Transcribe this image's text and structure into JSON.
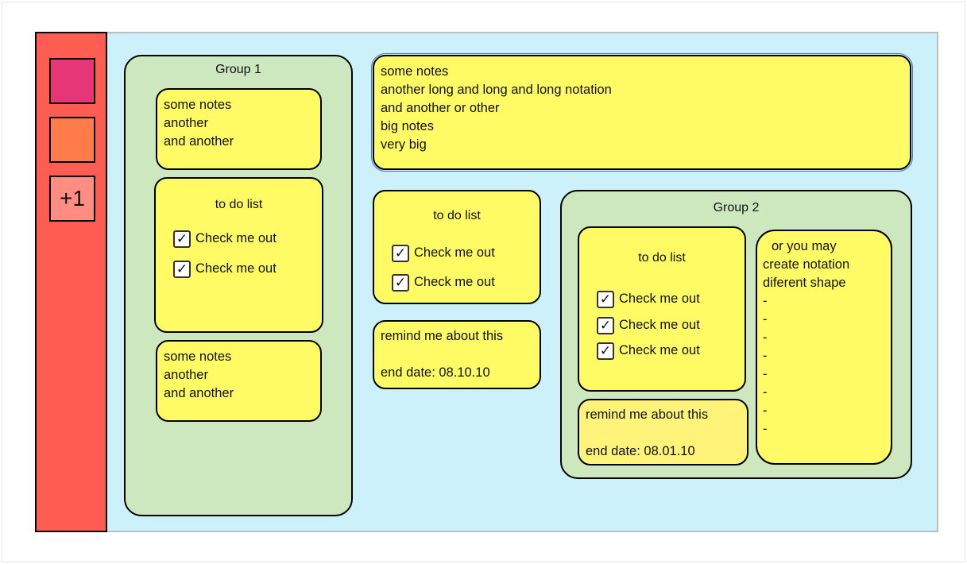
{
  "colors": {
    "sidebar": "#ff5c52",
    "canvas": "#ccf1fb",
    "group": "#cde8bf",
    "note": "#fffb65",
    "swatch_pink": "#e73677",
    "swatch_orange": "#ff7b4a",
    "swatch_salmon": "#ff8d82"
  },
  "sidebar": {
    "plus_label": "+1"
  },
  "group1": {
    "title": "Group 1",
    "note_top": [
      "some notes",
      "another",
      "and another"
    ],
    "todo": {
      "title": "to do list",
      "items": [
        "Check me out",
        "Check me out"
      ]
    },
    "note_bottom": [
      "some notes",
      "another",
      "and another"
    ]
  },
  "big_note": [
    "some notes",
    "another long and long and long notation",
    "and another or other",
    "big notes",
    "very big"
  ],
  "middle": {
    "todo": {
      "title": "to do list",
      "items": [
        "Check me out",
        "Check me out"
      ]
    },
    "remind": {
      "text": "remind me about this",
      "date": "end date: 08.10.10"
    }
  },
  "group2": {
    "title": "Group 2",
    "todo": {
      "title": "to do list",
      "items": [
        "Check me out",
        "Check me out",
        "Check me out"
      ]
    },
    "remind": {
      "text": "remind me about this",
      "date": "end date: 08.01.10"
    },
    "shape_note": {
      "lines": [
        "or you may",
        "create notation",
        "diferent shape"
      ],
      "dashes": [
        "-",
        "-",
        "-",
        "-",
        "-",
        "-",
        "-",
        "-"
      ]
    }
  },
  "check_mark": "✓"
}
